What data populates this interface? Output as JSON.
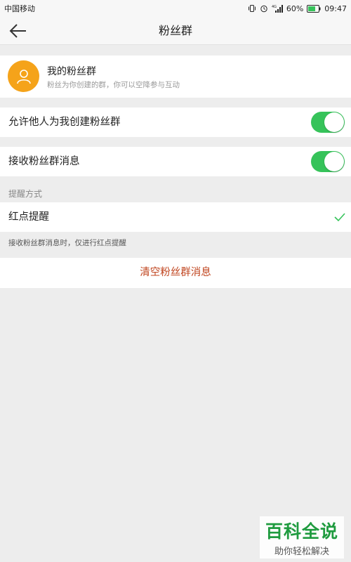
{
  "status_bar": {
    "carrier": "中国移动",
    "battery": "60%",
    "time": "09:47"
  },
  "header": {
    "title": "粉丝群"
  },
  "fan_group": {
    "title": "我的粉丝群",
    "subtitle": "粉丝为你创建的群，你可以空降参与互动"
  },
  "settings": {
    "allow_create": {
      "label": "允许他人为我创建粉丝群",
      "enabled": true
    },
    "receive_messages": {
      "label": "接收粉丝群消息",
      "enabled": true
    }
  },
  "reminder": {
    "section_label": "提醒方式",
    "option_label": "红点提醒",
    "hint": "接收粉丝群消息时，仅进行红点提醒"
  },
  "actions": {
    "clear_label": "清空粉丝群消息"
  },
  "watermark": {
    "main": "百科全说",
    "sub": "助你轻松解决"
  },
  "colors": {
    "toggle_on": "#36c35a",
    "avatar_bg": "#f5a31a",
    "danger_text": "#c0451f",
    "check": "#36c35a"
  }
}
